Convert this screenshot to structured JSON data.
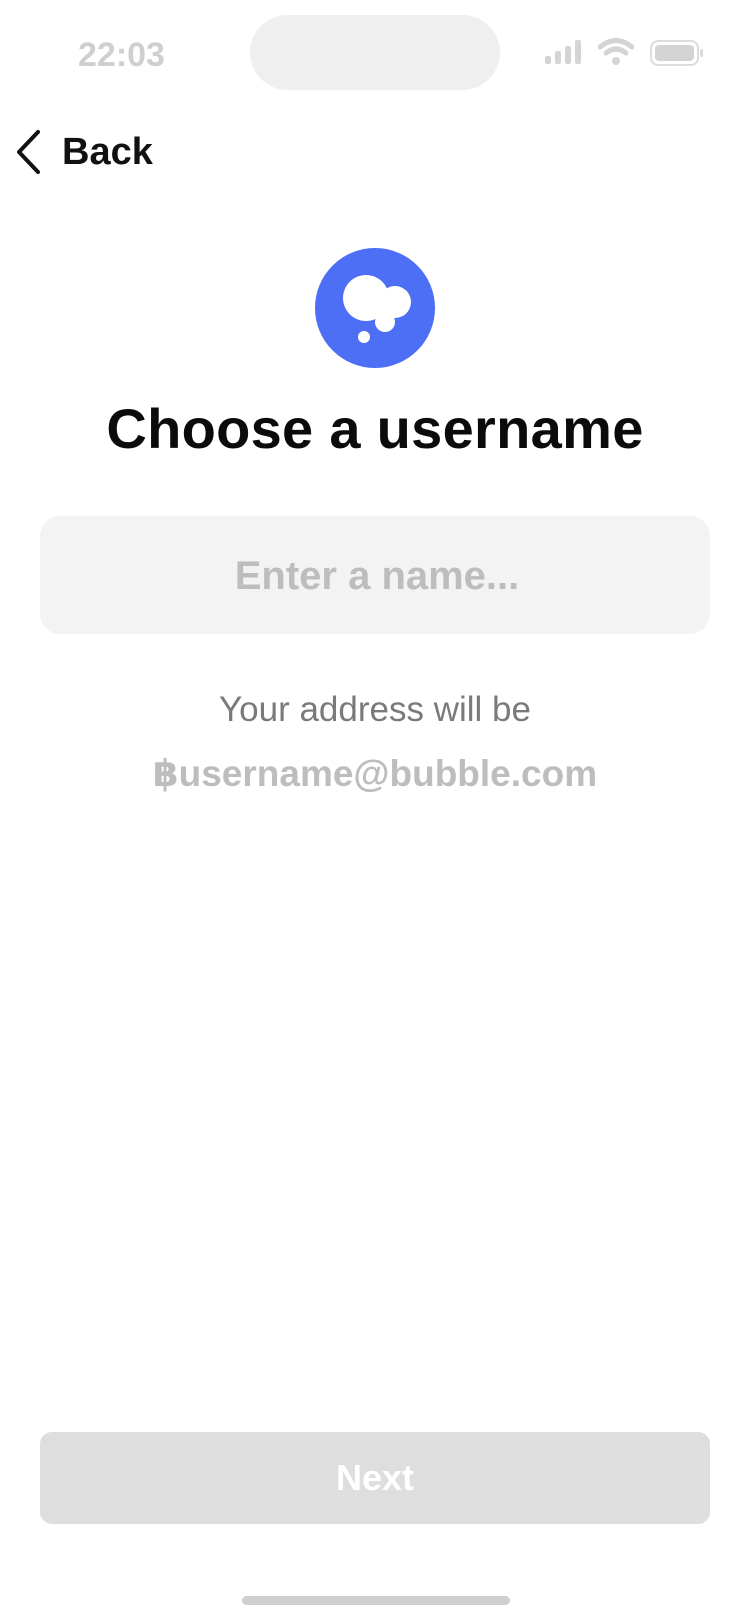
{
  "status_bar": {
    "time": "22:03",
    "icons": [
      "cellular-signal-icon",
      "wifi-icon",
      "battery-icon"
    ]
  },
  "nav": {
    "back_label": "Back",
    "back_icon": "chevron-left-icon"
  },
  "logo": {
    "icon": "thought-bubble-icon",
    "color": "#4C6FF5"
  },
  "page": {
    "title": "Choose a username"
  },
  "username_input": {
    "value": "",
    "placeholder": "Enter a name..."
  },
  "address_hint": {
    "label": "Your address will be",
    "example": "฿username@bubble.com"
  },
  "actions": {
    "next_label": "Next",
    "next_enabled": false
  },
  "colors": {
    "accent": "#4C6FF5",
    "input_bg": "#F3F3F3",
    "button_disabled": "#DEDEDE"
  }
}
